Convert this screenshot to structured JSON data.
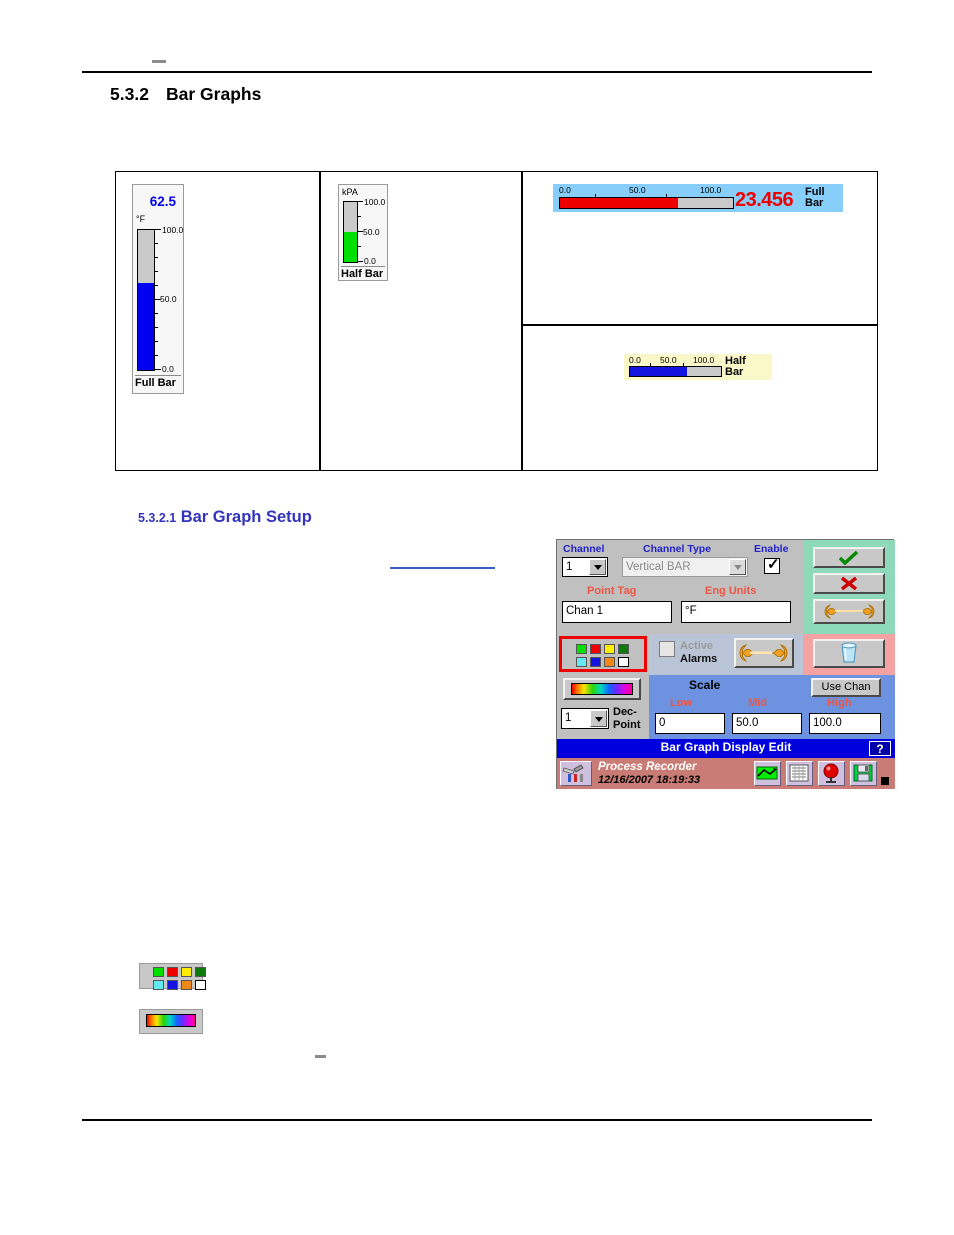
{
  "document": {
    "header_rule": true,
    "footer_rule": true,
    "section_number": "5.3.2",
    "section_title": "Bar Graphs",
    "subsection_number": "5.3.2.1",
    "subsection_title": "Bar Graph Setup"
  },
  "examples": {
    "vertical_full": {
      "value": "62.5",
      "units": "°F",
      "tick_top": "100.0",
      "tick_mid": "50.0",
      "tick_bottom": "0.0",
      "caption": "Full  Bar",
      "fill_color": "#0000ee",
      "fill_percent": 62.5,
      "track_color": "#c9c9c9"
    },
    "vertical_half": {
      "units": "kPA",
      "tick_top": "100.0",
      "tick_mid": "50.0",
      "tick_bottom": "0.0",
      "caption": "Half  Bar",
      "fill_color": "#00e000",
      "fill_percent": 50,
      "track_color": "#c9c9c9"
    },
    "horizontal_full": {
      "tick_low": "0.0",
      "tick_mid": "50.0",
      "tick_high": "100.0",
      "value": "23.456",
      "caption_line1": "Full",
      "caption_line2": "Bar",
      "background": "#87cefa",
      "fill_color": "#ee0000",
      "value_color": "#ee0000",
      "fill_percent": 68
    },
    "horizontal_half": {
      "tick_low": "0.0",
      "tick_mid": "50.0",
      "tick_high": "100.0",
      "caption_line1": "Half",
      "caption_line2": "Bar",
      "background": "#faf8c8",
      "fill_color": "#1414e0",
      "fill_percent": 63
    }
  },
  "setup_dialog": {
    "labels": {
      "channel": "Channel",
      "channel_type": "Channel Type",
      "enable": "Enable",
      "point_tag": "Point Tag",
      "eng_units": "Eng Units",
      "active_alarms_line1": "Active",
      "active_alarms_line2": "Alarms",
      "scale": "Scale",
      "low": "Low",
      "mid": "Mid",
      "high": "High",
      "use_chan": "Use Chan",
      "dec_point_line1": "Dec-",
      "dec_point_line2": "Point"
    },
    "values": {
      "channel": "1",
      "channel_type": "Vertical BAR",
      "enable_checked": true,
      "active_alarms_checked": false,
      "point_tag": "Chan 1",
      "eng_units": "°F",
      "scale_low": "0",
      "scale_mid": "50.0",
      "scale_high": "100.0",
      "dec_point": "1"
    },
    "title_bar": "Bar Graph Display Edit",
    "help_label": "?",
    "status": {
      "device": "Process Recorder",
      "timestamp": "12/16/2007 18:19:33"
    },
    "swatches": [
      "#00e000",
      "#ee0000",
      "#ffee00",
      "#0e7a0e",
      "#66e8f0",
      "#1414e0",
      "#ef8a17",
      "#ffffff"
    ],
    "colors": {
      "panel_ok": "#8fd9bb",
      "panel_delete": "#f4a2a2",
      "panel_scale": "#6d92e0",
      "panel_alarms": "#b9c4d6",
      "title_bar": "#0000dd",
      "status_bar": "#c97b75",
      "accent_red": "#ee0000"
    }
  },
  "inline_icons": {
    "palette_swatches": [
      "#00e000",
      "#ee0000",
      "#ffee00",
      "#0e7a0e",
      "#66e8f0",
      "#1414e0",
      "#ef8a17",
      "#ffffff"
    ],
    "gradient_name": "rainbow-gradient"
  }
}
